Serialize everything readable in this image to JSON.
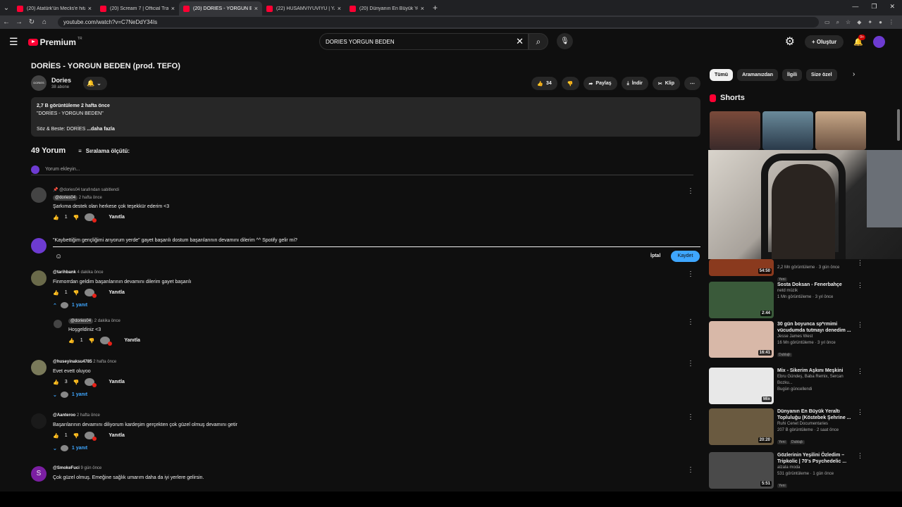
{
  "browser": {
    "tabs": [
      {
        "label": "(20) Atatürk'ün Meclis'e hitab",
        "active": false
      },
      {
        "label": "(20) Scream 7 | Official Trailer |",
        "active": false
      },
      {
        "label": "(20) DORİES - YORGUN BEDE",
        "active": true
      },
      {
        "label": "(22) HUSAMVIYUVIYU | YAKIŞI",
        "active": false
      },
      {
        "label": "(20) Dünyanın En Büyük Yeraltı",
        "active": false
      }
    ],
    "url": "youtube.com/watch?v=C7NeDdY34Is"
  },
  "header": {
    "brand": "Premium",
    "region": "TR",
    "search_value": "DORIES YORGUN BEDEN",
    "create_label": "Oluştur",
    "notif_count": "9+"
  },
  "video": {
    "title": "DORİES - YORGUN BEDEN (prod. TEFO)",
    "channel": "Dories",
    "subscribers": "38 abone",
    "likes": "34",
    "share": "Paylaş",
    "download": "İndir",
    "clip": "Klip",
    "desc_line1": "2,7 B görüntüleme  2 hafta önce",
    "desc_line2": "\"DORİES  -  YORGUN BEDEN\"",
    "desc_line3": "Söz & Beste: DORİES",
    "desc_more": "...daha fazla"
  },
  "comments": {
    "count": "49 Yorum",
    "sort": "Sıralama ölçütü:",
    "add_placeholder": "Yorum ekleyin...",
    "editor_text": "\"Kaybettiğim gençliğimi arıyorum yerde\" gayet başarılı dostum başarılarının devamını dilerim ^^  Spotify gelir mi?",
    "cancel": "İptal",
    "save": "Kaydet",
    "reply_label": "Yanıtla",
    "list": [
      {
        "pinned": "@dories04 tarafından sabitlendi",
        "author": "@dories04",
        "time": "2 hafta önce",
        "text": "Şarkıma destek olan herkese çok teşekkür ederim <3",
        "likes": "1"
      },
      {
        "author": "@tarihbank",
        "time": "4 dakika önce",
        "text": "Finmorrdan geldim başarılarının devamını dilerim gayet başarılı",
        "likes": "1",
        "replies": "1 yanıt"
      },
      {
        "author": "@dories04",
        "time": "2 dakika önce",
        "text": "Hoşgeldiniz <3",
        "likes": "1"
      },
      {
        "author": "@huseyinaksu4785",
        "time": "2 hafta önce",
        "text": "Evet evett oluyoo",
        "likes": "3",
        "replies": "1 yanıt"
      },
      {
        "author": "@Aanteroo",
        "time": "2 hafta önce",
        "text": "Başarılarının devamını diliyorum kardeşim gerçekten çok güzel olmuş devamını getir",
        "likes": "1",
        "replies": "1 yanıt"
      },
      {
        "author": "@SmokeFuci",
        "time": "9 gün önce",
        "text": "Çok güzel olmuş. Emeğine sağlık umarım daha da iyi yerlere gelirsin.",
        "avatar_letter": "S"
      }
    ]
  },
  "sidebar": {
    "chips": [
      "Tümü",
      "Aramanızdan",
      "İlgili",
      "Size özel"
    ],
    "shorts": "Shorts",
    "videos": [
      {
        "title": "",
        "channel": "",
        "meta": "2,2 Mn görüntüleme · 3 gün önce",
        "tag": "Yeni",
        "duration": "54:50",
        "thumb_color": "#8a3a1e"
      },
      {
        "title": "Sosta Doksan - Fenerbahçe",
        "channel": "netd müzik",
        "meta": "1 Mn görüntüleme · 3 yıl önce",
        "duration": "2:44",
        "thumb_color": "#3a5a3a"
      },
      {
        "title": "30 gün boyunca sp*rmimi vücudumda tutmayı denedim ...",
        "channel": "Jesse James West",
        "meta": "16 Mn görüntüleme · 3 yıl önce",
        "tag": "Dublajlı",
        "duration": "16:41",
        "thumb_color": "#d8b8a8"
      },
      {
        "title": "Mix - Sikerim Aşkını Meşkini",
        "channel": "Ebru Gündeş, Baba Remix, Sercan Bozku...",
        "meta": "Bugün güncellendi",
        "duration": "Mix",
        "thumb_color": "#e8e8e8"
      },
      {
        "title": "Dünyanın En Büyük Yeraltı Topluluğu (Köstebek Şehrine ...",
        "channel": "Ruhi Cenet Documentaries",
        "meta": "207 B görüntüleme · 2 saat önce",
        "tag": "Yeni",
        "tag2": "Dublajlı",
        "duration": "20:20",
        "thumb_color": "#6a5a40"
      },
      {
        "title": "Gözlerinin Yeşilini Özledim – Tripkolic | 70's Psychedelic ...",
        "channel": "alzala moda",
        "meta": "531 görüntüleme · 1 gün önce",
        "tag": "Yeni",
        "duration": "5:51",
        "thumb_color": "#4a4a4a"
      }
    ]
  }
}
